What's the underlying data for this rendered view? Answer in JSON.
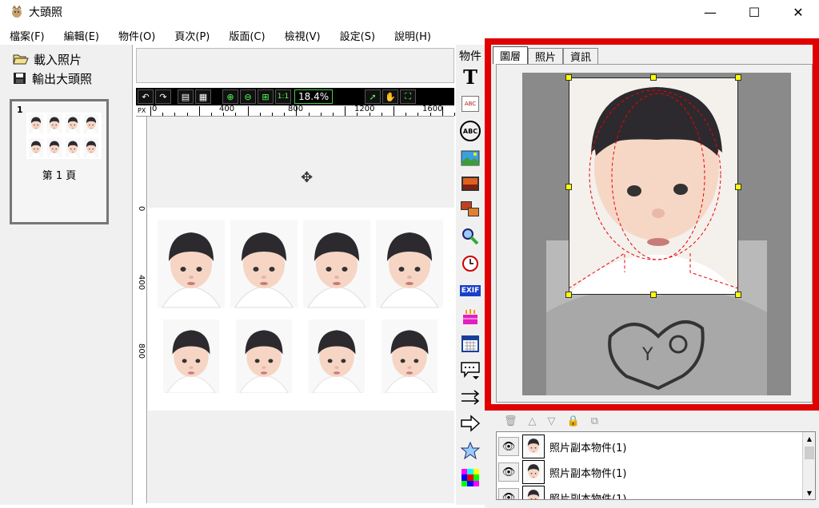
{
  "window": {
    "title": "大頭照",
    "minimize": "—",
    "maximize": "☐",
    "close": "✕"
  },
  "menu": [
    {
      "id": "file",
      "label": "檔案(F)"
    },
    {
      "id": "edit",
      "label": "編輯(E)"
    },
    {
      "id": "object",
      "label": "物件(O)"
    },
    {
      "id": "page",
      "label": "頁次(P)"
    },
    {
      "id": "layout",
      "label": "版面(C)"
    },
    {
      "id": "view",
      "label": "檢視(V)"
    },
    {
      "id": "settings",
      "label": "設定(S)"
    },
    {
      "id": "help",
      "label": "說明(H)"
    }
  ],
  "left_panel": {
    "load_photo": "載入照片",
    "export_photo": "輸出大頭照",
    "page_thumbnail": {
      "number": "1",
      "label": "第 1 頁"
    }
  },
  "toolbar": {
    "zoom": "18.4%"
  },
  "ruler": {
    "unit": "PX",
    "h_labels": [
      "0",
      "400",
      "800",
      "1200",
      "1600"
    ],
    "v_labels": [
      "0",
      "400",
      "800"
    ]
  },
  "object_panel": {
    "label": "物件",
    "tools": [
      {
        "id": "text",
        "glyph": "T"
      },
      {
        "id": "word-art",
        "glyph": "ABC"
      },
      {
        "id": "abc-circle",
        "glyph": "ABC"
      }
    ],
    "exif_label": "EXIF"
  },
  "right_panel": {
    "tabs": [
      {
        "id": "layers",
        "label": "圖層",
        "active": true
      },
      {
        "id": "photo",
        "label": "照片",
        "active": false
      },
      {
        "id": "info",
        "label": "資訊",
        "active": false
      }
    ],
    "layers": [
      {
        "name": "照片副本物件(1)"
      },
      {
        "name": "照片副本物件(1)"
      },
      {
        "name": "照片副本物件(1)"
      }
    ]
  },
  "colors": {
    "highlight_frame": "#e00000",
    "handle": "#ffff00",
    "toolbar_bg": "#000000"
  }
}
